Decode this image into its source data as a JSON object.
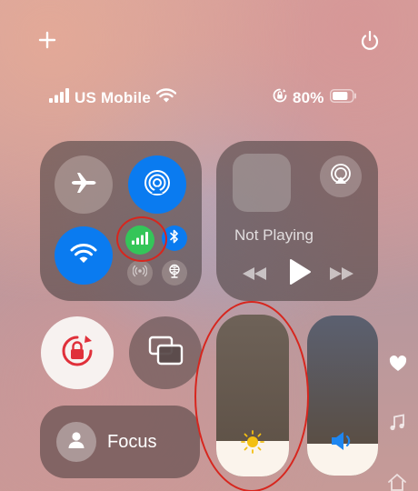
{
  "top_bar": {
    "add_icon": "plus-icon",
    "power_icon": "power-icon"
  },
  "status_bar": {
    "carrier": "US Mobile",
    "signal_icon": "cellular-signal-icon",
    "wifi_icon": "wifi-icon",
    "lock_icon": "orientation-lock-icon",
    "battery_percent": "80%",
    "battery_level": 0.8
  },
  "connectivity": {
    "airplane": {
      "icon": "airplane-icon",
      "active": false
    },
    "airdrop": {
      "icon": "airdrop-icon",
      "active": true
    },
    "wifi": {
      "icon": "wifi-icon",
      "active": true
    },
    "cellular": {
      "icon": "cellular-data-icon",
      "active": true
    },
    "bluetooth": {
      "icon": "bluetooth-icon",
      "active": true
    },
    "hotspot": {
      "icon": "personal-hotspot-icon",
      "active": false
    },
    "globe": {
      "icon": "globe-icon",
      "active": false
    }
  },
  "media": {
    "status": "Not Playing",
    "airplay_icon": "airplay-icon",
    "rewind_icon": "rewind-icon",
    "play_icon": "play-icon",
    "forward_icon": "fast-forward-icon"
  },
  "controls": {
    "rotation_lock_icon": "rotation-lock-icon",
    "screen_mirroring_icon": "screen-mirroring-icon",
    "focus": {
      "label": "Focus",
      "icon": "person-icon"
    }
  },
  "sliders": {
    "brightness": {
      "icon": "sun-icon",
      "level": 0.22
    },
    "volume": {
      "icon": "speaker-icon",
      "level": 0.2
    }
  },
  "side_icons": [
    "heart-icon",
    "music-note-icon",
    "home-icon"
  ],
  "annotations": {
    "color": "#d7261e"
  },
  "colors": {
    "accent_blue": "#0a7bf0",
    "cellular_green": "#34c559"
  }
}
